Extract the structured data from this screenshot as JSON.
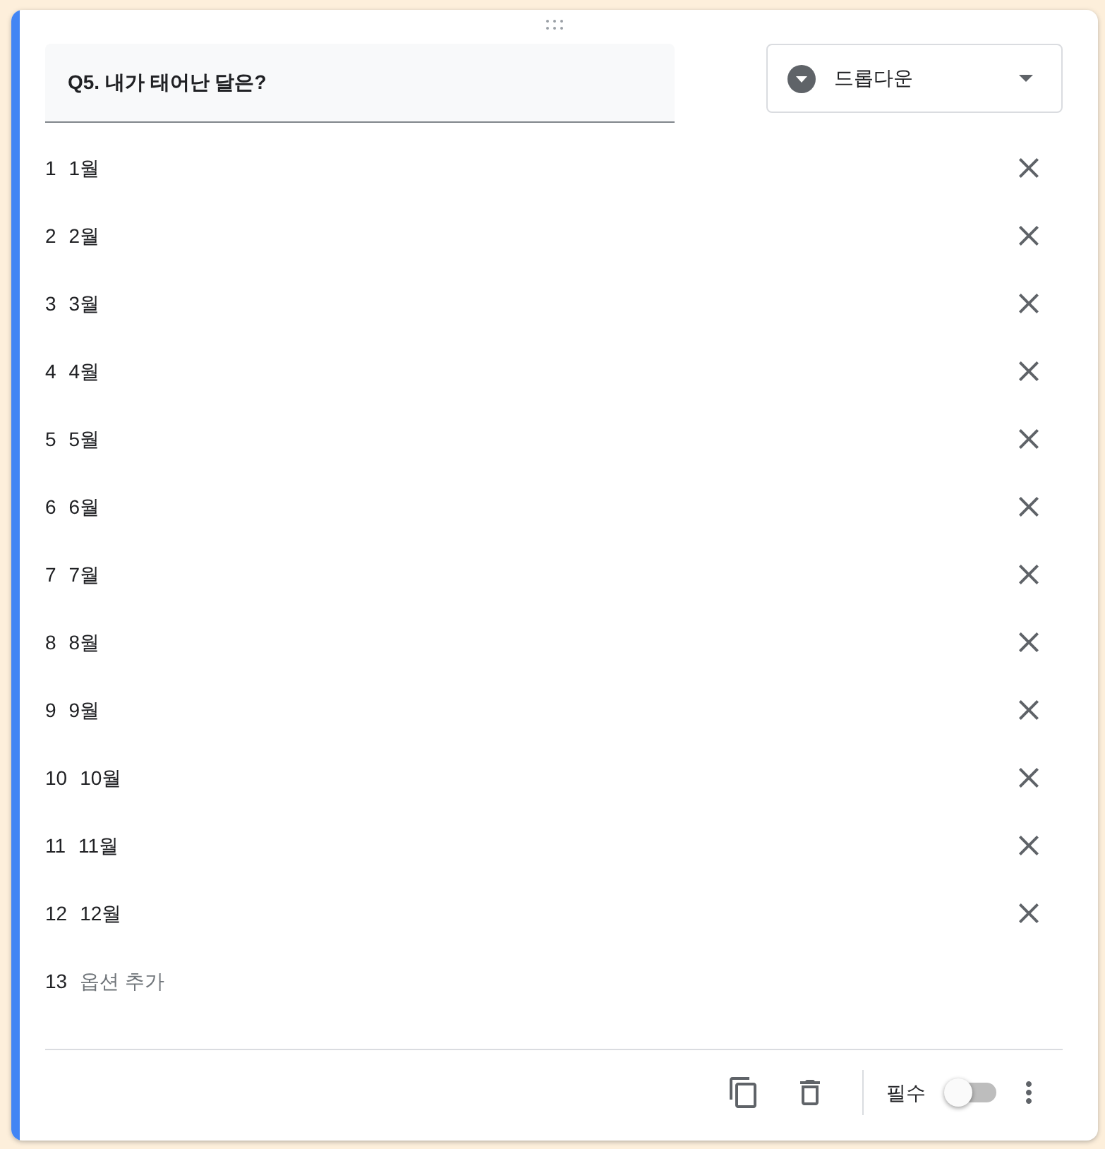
{
  "card": {
    "focused": true
  },
  "question": {
    "title": "Q5. 내가 태어난 달은?",
    "type_label": "드롭다운"
  },
  "options": [
    {
      "number": "1",
      "label": "1월"
    },
    {
      "number": "2",
      "label": "2월"
    },
    {
      "number": "3",
      "label": "3월"
    },
    {
      "number": "4",
      "label": "4월"
    },
    {
      "number": "5",
      "label": "5월"
    },
    {
      "number": "6",
      "label": "6월"
    },
    {
      "number": "7",
      "label": "7월"
    },
    {
      "number": "8",
      "label": "8월"
    },
    {
      "number": "9",
      "label": "9월"
    },
    {
      "number": "10",
      "label": "10월"
    },
    {
      "number": "11",
      "label": "11월"
    },
    {
      "number": "12",
      "label": "12월"
    }
  ],
  "add_option": {
    "number": "13",
    "label": "옵션 추가"
  },
  "footer": {
    "required_label": "필수",
    "required": false
  }
}
